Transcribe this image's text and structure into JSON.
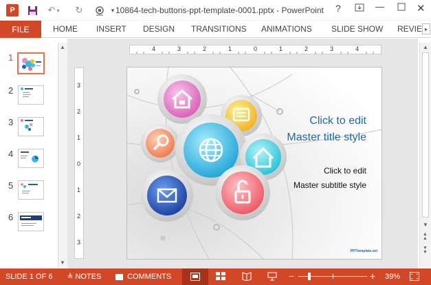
{
  "app": {
    "doc_title": "10864-tech-buttons-ppt-template-0001.pptx - PowerPoint",
    "help": "?",
    "accent": "#d24726"
  },
  "quick_access": {
    "app_icon": "P",
    "save_icon": "save-icon",
    "undo_icon": "undo-icon",
    "redo_icon": "repeat-icon",
    "present_icon": "present-icon"
  },
  "ribbon": {
    "file": "FILE",
    "tabs": [
      "HOME",
      "INSERT",
      "DESIGN",
      "TRANSITIONS",
      "ANIMATIONS",
      "SLIDE SHOW",
      "REVIEW"
    ]
  },
  "thumbnails": [
    "1",
    "2",
    "3",
    "4",
    "5",
    "6"
  ],
  "slide": {
    "title_line1": "Click to edit",
    "title_line2": "Master title style",
    "subtitle_line1": "Click to edit",
    "subtitle_line2": "Master subtitle style",
    "brand": "PPTtemplate.net"
  },
  "ruler": {
    "h_labels": [
      "4",
      "3",
      "2",
      "1",
      "0",
      "1",
      "2",
      "3",
      "4"
    ],
    "v_labels": [
      "3",
      "2",
      "1",
      "0",
      "1",
      "2",
      "3"
    ]
  },
  "status": {
    "slide_info": "SLIDE 1 OF 6",
    "notes": "NOTES",
    "comments": "COMMENTS",
    "zoom": "39%",
    "zoom_minus": "−",
    "zoom_plus": "+"
  }
}
